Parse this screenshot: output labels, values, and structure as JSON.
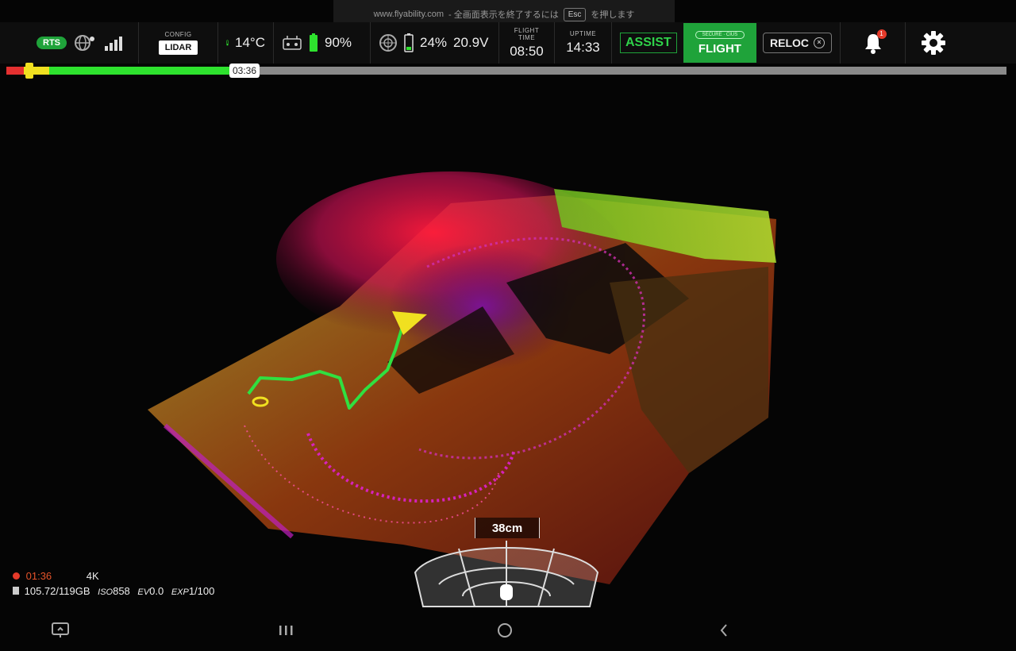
{
  "fullscreen_banner": {
    "url": "www.flyability.com",
    "text": "- 全画面表示を終了するには",
    "key": "Esc",
    "suffix": "を押します"
  },
  "status_bar": {
    "rts_label": "RTS",
    "config_label": "CONFIG",
    "lidar_label": "LIDAR",
    "temperature": "14°C",
    "controller_battery": "90%",
    "drone_battery": "24%",
    "voltage": "20.9V",
    "flight_time_label": "FLIGHT TIME",
    "flight_time": "08:50",
    "uptime_label": "UPTIME",
    "uptime": "14:33",
    "assist_label": "ASSIST",
    "flight_mode_sub": "SECURE · CIUS",
    "flight_label": "FLIGHT",
    "reloc_label": "RELOC",
    "notification_count": "1"
  },
  "timeline": {
    "current_time": "03:36",
    "progress_fraction": 0.225
  },
  "recording": {
    "time": "01:36",
    "resolution": "4K",
    "storage": "105.72/119GB",
    "iso_prefix": "ISO",
    "iso": "858",
    "ev_prefix": "EV",
    "ev": "0.0",
    "exp_prefix": "EXP",
    "exp": "1/100"
  },
  "distance": {
    "value": "38cm"
  },
  "colors": {
    "accent_green": "#1fa33a",
    "progress_green": "#2ee22e",
    "alert_red": "#e53030",
    "marker_yellow": "#f0e020"
  }
}
